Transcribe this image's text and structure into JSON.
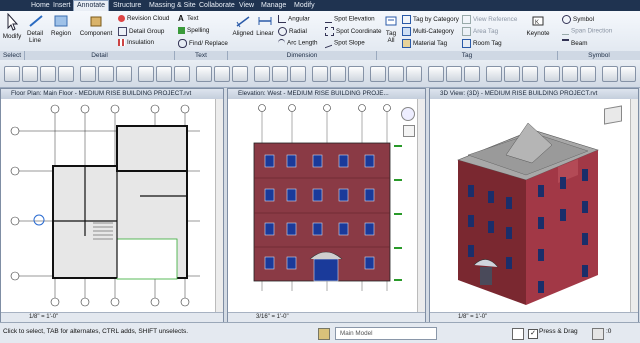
{
  "tabs": [
    "Home",
    "Insert",
    "Annotate",
    "Structure",
    "Massing & Site",
    "Collaborate",
    "View",
    "Manage",
    "Modify"
  ],
  "ribbon": {
    "modify": "Modify",
    "detail_line": "Detail Line",
    "region": "Region",
    "component": "Component",
    "revision_cloud": "Revision Cloud",
    "detail_group": "Detail Group",
    "insulation": "Insulation",
    "text": "Text",
    "spelling": "Spelling",
    "find_replace": "Find/ Replace",
    "aligned": "Aligned",
    "linear": "Linear",
    "angular": "Angular",
    "radial": "Radial",
    "arc_length": "Arc Length",
    "spot_elevation": "Spot Elevation",
    "spot_coordinate": "Spot Coordinate",
    "spot_slope": "Spot Slope",
    "tag_all": "Tag All",
    "tag_by_category": "Tag by Category",
    "multi_category": "Multi-Category",
    "material_tag": "Material Tag",
    "view_reference": "View Reference",
    "area_tag": "Area Tag",
    "room_tag": "Room Tag",
    "keynote": "Keynote",
    "symbol": "Symbol",
    "span_direction": "Span Direction",
    "beam": "Beam",
    "groups": [
      "Select",
      "Detail",
      "Text",
      "Dimension",
      "Tag",
      "Symbol"
    ]
  },
  "views": {
    "floor_plan_title": "Floor Plan: Main Floor - MEDIUM RISE BUILDING PROJECT.rvt",
    "elevation_title": "Elevation: West - MEDIUM RISE BUILDING PROJE...",
    "view3d_title": "3D View: {3D} - MEDIUM RISE BUILDING PROJECT.rvt",
    "floor_scale": "1/8\" = 1'-0\"",
    "elev_scale": "3/16\" = 1'-0\"",
    "view3d_scale": "1/8\" = 1'-0\""
  },
  "status": {
    "text": "Click to select, TAB for alternates, CTRL adds, SHIFT unselects.",
    "model": "Main Model",
    "press_drag": "Press & Drag",
    "zero": ":0"
  }
}
